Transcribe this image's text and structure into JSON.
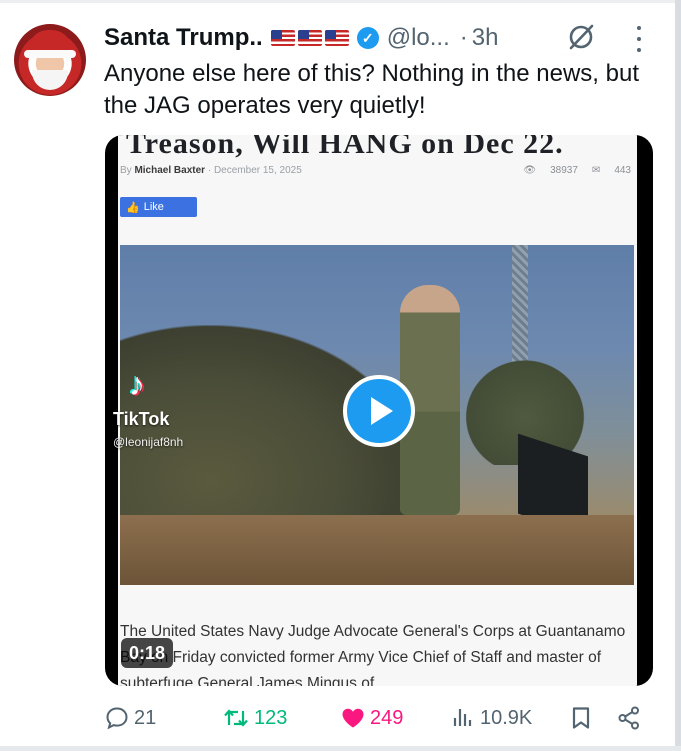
{
  "tweet": {
    "display_name": "Santa Trump..",
    "handle": "@lo...",
    "time_separator": "·",
    "time": "3h",
    "text": "Anyone else here of this? Nothing in the news, but the JAG operates very quietly!",
    "verified_icon": "verified-badge-icon",
    "flags_icon": "us-flag-icon"
  },
  "media": {
    "headline": "Treason, Will HANG on Dec 22.",
    "byline_prefix": "By",
    "author": "Michael Baxter",
    "date": "December 15, 2025",
    "views": "38937",
    "comments": "443",
    "like_button": "Like",
    "caption": "The United States Navy Judge Advocate General's Corps at Guantanamo Bay on Friday convicted former Army Vice Chief of Staff and master of subterfuge General James Mingus of",
    "watermark_brand": "TikTok",
    "watermark_user": "@leonijaf8nh",
    "duration": "0:18"
  },
  "actions": {
    "replies": "21",
    "retweets": "123",
    "likes": "249",
    "views": "10.9K"
  },
  "colors": {
    "accent_blue": "#1d9bf0",
    "retweet_green": "#00ba7c",
    "like_pink": "#f91880",
    "muted": "#536471"
  }
}
